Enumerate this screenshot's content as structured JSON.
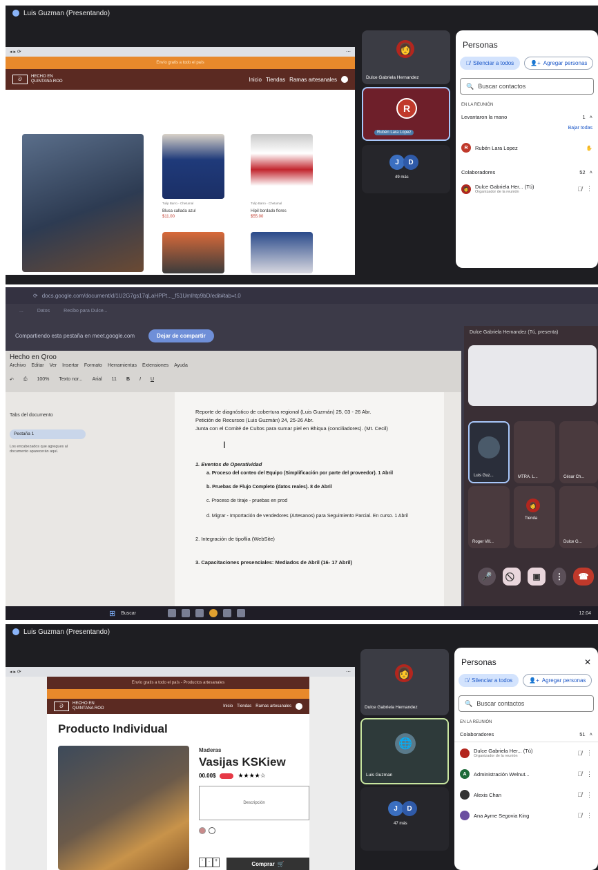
{
  "panel1": {
    "presenter_title": "Luis Guzman (Presentando)",
    "site": {
      "banner": "Envío gratis a todo el país",
      "logo_line1": "HECHO EN",
      "logo_line2": "QUINTANA ROO",
      "nav": [
        "Inicio",
        "Tiendas",
        "Ramas artesanales"
      ]
    },
    "products": [
      {
        "shop": "Tulip Barro - Chetumal",
        "name": "Blusa callada azul",
        "price": "$11.00"
      },
      {
        "shop": "Tulip Barro - Chetumal",
        "name": "Hipil bordado flores",
        "price": "$55.00"
      }
    ],
    "tiles": {
      "top_name": "Dulce Gabriela Hernandez",
      "mid_name": "Rubén Lara Lopez",
      "mid_initial": "R",
      "more_initials": [
        "J",
        "D"
      ],
      "more_label": "49 más"
    },
    "people": {
      "title": "Personas",
      "mute_all": "Silenciar a todos",
      "add": "Agregar personas",
      "search_placeholder": "Buscar contactos",
      "section": "EN LA REUNIÓN",
      "raised_label": "Levantaron la mano",
      "raised_count": "1",
      "lower_all": "Bajar todas",
      "raised_person": "Rubén Lara Lopez",
      "raised_initial": "R",
      "collab_label": "Colaboradores",
      "collab_count": "52",
      "collab_person": "Dulce Gabriela Her... (Tú)",
      "collab_role": "Organizador de la reunión"
    }
  },
  "panel2": {
    "url": "docs.google.com/document/d/1U2G7gs17qLaHPPt..._f51Umlhtp9bD/edit#tab=t.0",
    "bookmarks": [
      "...",
      "Datos",
      "Recibo para Dulce..."
    ],
    "sharing_notice": "Compartiendo esta pestaña en meet.google.com",
    "stop_sharing": "Dejar de compartir",
    "doc_title": "Hecho en Qroo",
    "menu": [
      "Archivo",
      "Editar",
      "Ver",
      "Insertar",
      "Formato",
      "Herramientas",
      "Extensiones",
      "Ayuda"
    ],
    "toolbar": {
      "zoom": "100%",
      "style": "Texto nor...",
      "font": "Arial",
      "size": "11"
    },
    "outline_title": "Tabs del documento",
    "outline_tab": "Pestaña 1",
    "outline_hint": "Los encabezados que agregues al documento aparecerán aquí.",
    "bullets": [
      "Reporte de diagnóstico de cobertura regional (Luis Guzmán) 25, 03 - 26 Abr.",
      "Petición de Recursos (Luis Guzmán) 24, 25-26 Abr.",
      "Junta con el Comité de Cultos para sumar piel en Bhiqua (conciliadores). (Mt. Cecil)"
    ],
    "section1_title": "1. Eventos de Operatividad",
    "sub_items": [
      "a. Proceso del conteo del Equipo (Simplificación por parte del proveedor). 1 Abril",
      "b. Pruebas de Flujo Completo (datos reales). 8 de Abril",
      "c. Proceso de tiraje - pruebas en prod",
      "d. Migrar - Importación de vendedores (Artesanos) para Seguimiento Parcial. En curso. 1 Abril"
    ],
    "section2": "2. Integración de tipoflia (WebSite)",
    "section3": "3. Capacitaciones presenciales: Mediados de Abril (16- 17 Abril)",
    "right_header": "Dulce Gabriela Hernandez (Tú, presenta)",
    "tile_names": [
      "Luis Guz...",
      "MTRA. L...",
      "César Ch...",
      "Roger Vill...",
      "Tienda",
      "Dulce G..."
    ],
    "taskbar_search": "Buscar",
    "taskbar_time": "12:04"
  },
  "panel3": {
    "presenter_title": "Luis Guzman (Presentando)",
    "site": {
      "banner": "Envío gratis a todo el país - Productos artesanales",
      "logo_line1": "HECHO EN",
      "logo_line2": "QUINTANA ROO",
      "nav": [
        "Inicio",
        "Tiendas",
        "Ramas artesanales"
      ]
    },
    "page_title": "Producto Individual",
    "category": "Maderas",
    "product_name": "Vasijas KSKiew",
    "price": "00.00$",
    "stars": "★★★★☆",
    "description": "Descripción",
    "buy": "Comprar",
    "tiles": {
      "top_name": "Dulce Gabriela Hernandez",
      "mid_name": "Luis Guzman",
      "more_initials": [
        "J",
        "D"
      ],
      "more_label": "47 más"
    },
    "people": {
      "title": "Personas",
      "mute_all": "Silenciar a todos",
      "add": "Agregar personas",
      "search_placeholder": "Buscar contactos",
      "section": "EN LA REUNIÓN",
      "collab_label": "Colaboradores",
      "collab_count": "51",
      "list": [
        {
          "name": "Dulce Gabriela Her... (Tú)",
          "role": "Organizador de la reunión",
          "initial": "",
          "color": "#b3261e"
        },
        {
          "name": "Administración Welnut...",
          "role": "",
          "initial": "A",
          "color": "#1e6b3a"
        },
        {
          "name": "Alexis Chan",
          "role": "",
          "initial": "",
          "color": "#333333"
        },
        {
          "name": "Ana Ayme Segovia King",
          "role": "",
          "initial": "",
          "color": "#6b4fa0"
        }
      ]
    }
  }
}
